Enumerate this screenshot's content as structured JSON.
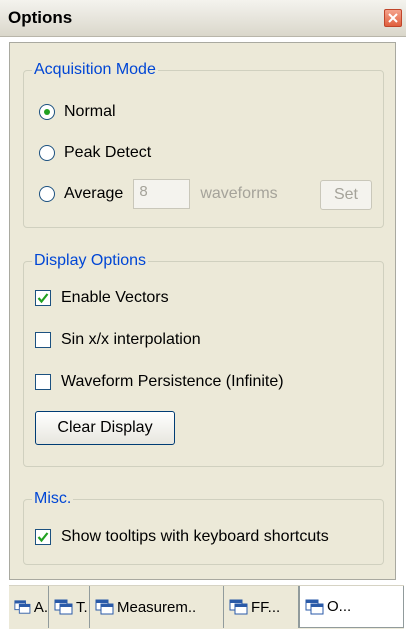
{
  "window": {
    "title": "Options"
  },
  "acquisition": {
    "legend": "Acquisition Mode",
    "modes": [
      "Normal",
      "Peak Detect",
      "Average"
    ],
    "selected": "Normal",
    "average_value": "8",
    "average_unit": "waveforms",
    "set_label": "Set"
  },
  "display": {
    "legend": "Display Options",
    "enable_vectors": {
      "label": "Enable Vectors",
      "checked": true
    },
    "sinx": {
      "label": "Sin x/x interpolation",
      "checked": false
    },
    "persistence": {
      "label": "Waveform Persistence (Infinite)",
      "checked": false
    },
    "clear_label": "Clear Display"
  },
  "misc": {
    "legend": "Misc.",
    "tooltips": {
      "label": "Show tooltips with keyboard shortcuts",
      "checked": true
    }
  },
  "tabs": [
    {
      "label": "A.",
      "icon": "window-icon",
      "active": false
    },
    {
      "label": "T.",
      "icon": "window-icon",
      "active": false
    },
    {
      "label": "Measurem..",
      "icon": "window-icon",
      "active": false
    },
    {
      "label": "FF...",
      "icon": "window-icon",
      "active": false
    },
    {
      "label": "O...",
      "icon": "window-icon",
      "active": true
    }
  ],
  "colors": {
    "legend_text": "#0046d5",
    "panel_bg": "#ece9d8",
    "close_button": "#e0603e"
  }
}
